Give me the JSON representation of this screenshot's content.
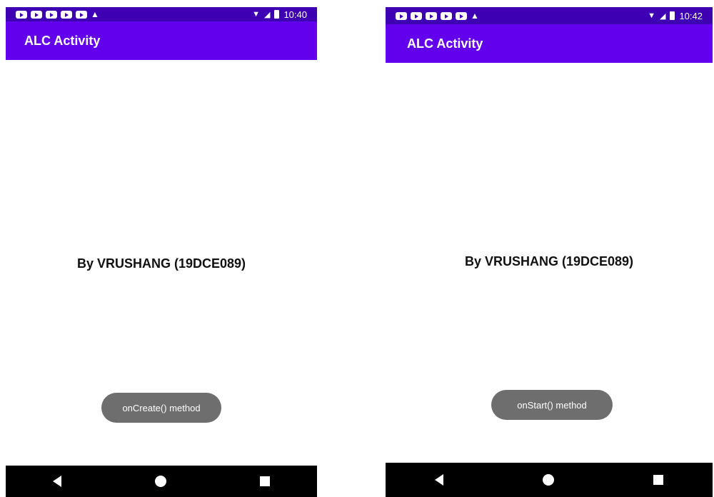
{
  "screens": [
    {
      "status_time": "10:40",
      "app_title": "ALC Activity",
      "main_text": "By VRUSHANG (19DCE089)",
      "toast_text": "onCreate() method"
    },
    {
      "status_time": "10:42",
      "app_title": "ALC Activity",
      "main_text": "By VRUSHANG (19DCE089)",
      "toast_text": "onStart() method"
    }
  ],
  "colors": {
    "status_bar": "#3e00b3",
    "app_bar": "#6200ee",
    "toast": "#6e6e6e",
    "nav_bar": "#000000"
  },
  "icons": [
    "notification-icon",
    "warning-icon",
    "wifi-icon",
    "signal-icon",
    "battery-icon",
    "back-icon",
    "home-icon",
    "recents-icon"
  ]
}
